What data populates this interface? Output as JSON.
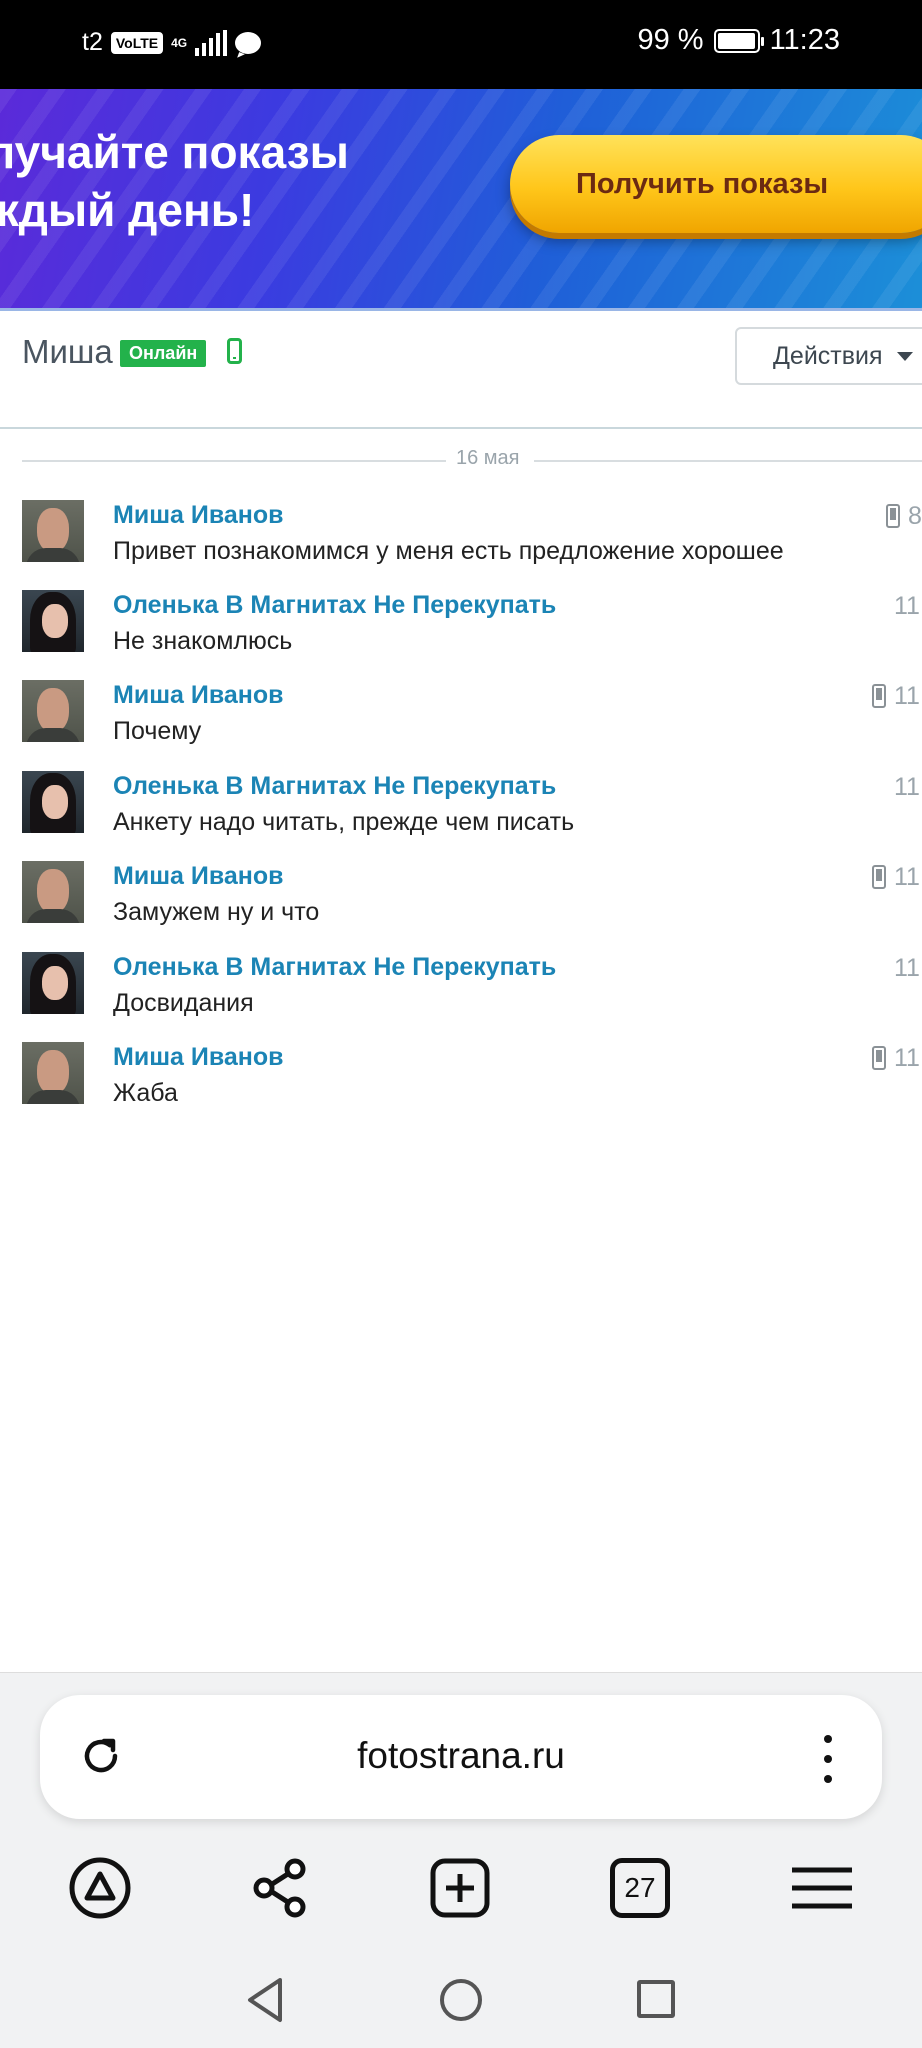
{
  "status_bar": {
    "carrier": "t2",
    "volte": "VoLTE",
    "network": "4G",
    "battery": "99 %",
    "time": "11:23"
  },
  "banner": {
    "text_line1": "лучайте показы",
    "text_line2": "ждый день!",
    "button_label": "Получить показы"
  },
  "header": {
    "name": "Миша",
    "online_badge": "Онлайн",
    "actions_label": "Действия"
  },
  "date_separator": "16 мая",
  "messages": [
    {
      "author": "Миша Иванов",
      "text": "Привет познакомимся у меня есть предложение хорошее",
      "time": "8",
      "from_mobile": true
    },
    {
      "author": "Оленька В Магнитах Не Перекупать",
      "text": "Не знакомлюсь",
      "time": "11",
      "from_mobile": false
    },
    {
      "author": "Миша Иванов",
      "text": "Почему",
      "time": "11",
      "from_mobile": true
    },
    {
      "author": "Оленька В Магнитах Не Перекупать",
      "text": "Анкету надо читать, прежде чем писать",
      "time": "11",
      "from_mobile": false
    },
    {
      "author": "Миша Иванов",
      "text": "Замужем ну и что",
      "time": "11",
      "from_mobile": true
    },
    {
      "author": "Оленька В Магнитах Не Перекупать",
      "text": "Досвидания",
      "time": "11",
      "from_mobile": false
    },
    {
      "author": "Миша Иванов",
      "text": "Жаба",
      "time": "11",
      "from_mobile": true
    }
  ],
  "browser": {
    "url": "fotostrana.ru",
    "tabs_count": "27"
  },
  "icons": {
    "reload": "reload-icon",
    "more": "more-vertical-icon",
    "alice": "alice-icon",
    "share": "share-icon",
    "new_tab": "new-tab-icon",
    "tabs": "tabs-icon",
    "menu": "menu-icon",
    "nav_back": "back-triangle-icon",
    "nav_home": "home-circle-icon",
    "nav_recent": "recent-square-icon"
  },
  "colors": {
    "online_green": "#23b24b",
    "author_blue": "#1b84b5",
    "banner_button": "#ffc61a"
  }
}
